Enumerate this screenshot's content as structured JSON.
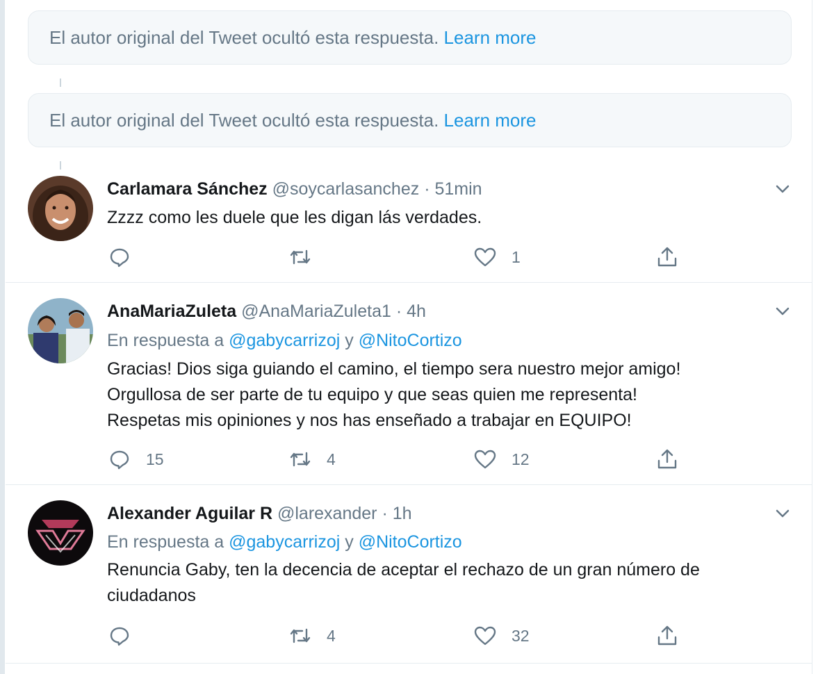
{
  "hidden_replies": [
    {
      "text": "El autor original del Tweet ocultó esta respuesta.",
      "link": "Learn more"
    },
    {
      "text": "El autor original del Tweet ocultó esta respuesta.",
      "link": "Learn more"
    }
  ],
  "tweets": [
    {
      "name": "Carlamara Sánchez",
      "handle": "@soycarlasanchez",
      "dot": "·",
      "time": "51min",
      "reply_prefix": "",
      "mention1": "",
      "conj": "",
      "mention2": "",
      "lines": [
        "Zzzz como les duele que les digan lás verdades."
      ],
      "replies": "",
      "retweets": "",
      "likes": "1"
    },
    {
      "name": "AnaMariaZuleta",
      "handle": "@AnaMariaZuleta1",
      "dot": "·",
      "time": "4h",
      "reply_prefix": "En respuesta a",
      "mention1": "@gabycarrizoj",
      "conj": "y",
      "mention2": "@NitoCortizo",
      "lines": [
        "Gracias! Dios siga guiando el camino, el tiempo sera nuestro mejor amigo!",
        "Orgullosa de ser parte de tu equipo y que seas quien me representa!",
        "Respetas mis opiniones y nos has enseñado a trabajar en EQUIPO!"
      ],
      "replies": "15",
      "retweets": "4",
      "likes": "12"
    },
    {
      "name": "Alexander Aguilar R",
      "handle": "@larexander",
      "dot": "·",
      "time": "1h",
      "reply_prefix": "En respuesta a",
      "mention1": "@gabycarrizoj",
      "conj": "y",
      "mention2": "@NitoCortizo",
      "lines": [
        "Renuncia Gaby, ten la decencia de aceptar el rechazo de un gran número de",
        "ciudadanos"
      ],
      "replies": "",
      "retweets": "4",
      "likes": "32"
    }
  ],
  "colors": {
    "link": "#1b95e0",
    "secondary_text": "#657786",
    "primary_text": "#14171a",
    "notice_bg": "#f5f8fa"
  }
}
